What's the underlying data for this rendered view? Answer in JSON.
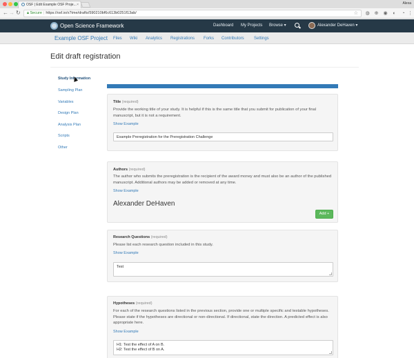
{
  "browser": {
    "tab_title": "OSF | Edit Example OSF Proje...",
    "tab_close": "×",
    "profile_name": "Alexa",
    "secure_label": "Secure",
    "url": "https://osf.io/x7tme/drafts/590210bf6c613b0251f13ab/",
    "star": "☆",
    "back": "←",
    "forward": "→",
    "reload": "↻"
  },
  "navbar": {
    "brand": "Open Science Framework",
    "links": [
      "Dashboard",
      "My Projects",
      "Browse ▾"
    ],
    "user": "Alexander DeHaven ▾"
  },
  "project_nav": {
    "title": "Example OSF Project",
    "links": [
      "Files",
      "Wiki",
      "Analytics",
      "Registrations",
      "Forks",
      "Contributors",
      "Settings"
    ]
  },
  "page_title": "Edit draft registration",
  "sidebar": {
    "items": [
      "Study Information",
      "Sampling Plan",
      "Variables",
      "Design Plan",
      "Analysis Plan",
      "Scripts",
      "Other"
    ]
  },
  "questions": {
    "title": {
      "label": "Title",
      "required": "(required)",
      "description": "Provide the working title of your study. It is helpful if this is the same title that you submit for publication of your final manuscript, but it is not a requirement.",
      "show_example": "Show Example",
      "value": "Example Preregistration for the Preregistration Challenge"
    },
    "authors": {
      "label": "Authors",
      "required": "(required)",
      "description": "The author who submits the preregistration is the recipient of the award money and must also be an author of the published manuscript. Additional authors may be added or removed at any time.",
      "show_example": "Show Example",
      "author_name": "Alexander DeHaven",
      "add_button": "Add +"
    },
    "research_questions": {
      "label": "Research Questions",
      "required": "(required)",
      "description": "Please list each research question included in this study.",
      "show_example": "Show Example",
      "value": "Test"
    },
    "hypotheses": {
      "label": "Hypotheses",
      "required": "(required)",
      "description": "For each of the research questions listed in the previous section, provide one or multiple specific and testable hypotheses. Please state if the hypotheses are directional or non-directional. If directional, state the direction. A predicted effect is also appropriate here.",
      "show_example": "Show Example",
      "value": "H1: Test the effect of A on B.\nH2: Test the effect of B on A."
    }
  },
  "colors": {
    "navbar_bg": "#263947",
    "link": "#337ab7",
    "progress": "#337ab7",
    "add_button": "#5cb85c"
  }
}
